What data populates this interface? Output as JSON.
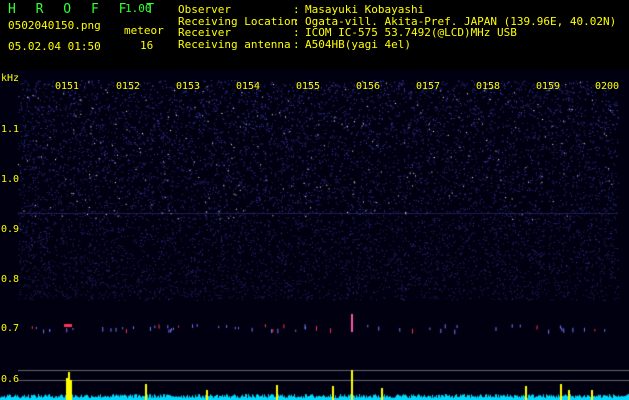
{
  "header": {
    "app_title": "H R O F F T",
    "version": "1.00",
    "filename": "0502040150.png",
    "datetime": "05.02.04 01:50",
    "meteor_label": "meteor",
    "meteor_count": "16"
  },
  "info": [
    {
      "key": "Observer",
      "sep": ":",
      "value": "Masayuki Kobayashi"
    },
    {
      "key": "Receiving Location",
      "sep": ":",
      "value": "Ogata-vill. Akita-Pref. JAPAN (139.96E, 40.02N)"
    },
    {
      "key": "Receiver",
      "sep": ":",
      "value": "ICOM IC-575 53.7492(@LCD)MHz USB"
    },
    {
      "key": "Receiving antenna",
      "sep": ":",
      "value": "A504HB(yagi 4el)"
    }
  ],
  "spectrogram": {
    "y_unit": "kHz",
    "y_ticks": [
      "1.1",
      "1.0",
      "0.9",
      "0.8",
      "0.7",
      "0.6"
    ],
    "time_labels": [
      "0151",
      "0152",
      "0153",
      "0154",
      "0155",
      "0156",
      "0157",
      "0158",
      "0159",
      "0200"
    ],
    "colors": {
      "text": "#ffff00",
      "title": "#33ff33",
      "noise": "#2a2aaa",
      "signal": "#ff3355",
      "level": "#00e5ff",
      "peak": "#ffff00"
    }
  }
}
